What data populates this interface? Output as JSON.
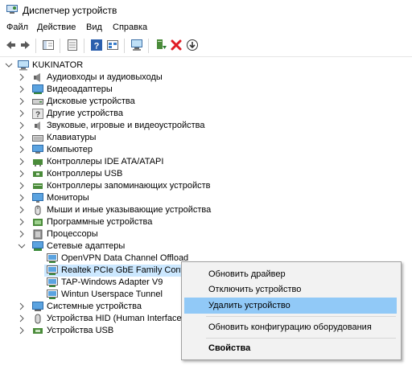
{
  "window": {
    "title": "Диспетчер устройств"
  },
  "menu": [
    {
      "id": "file",
      "label": "Файл"
    },
    {
      "id": "action",
      "label": "Действие"
    },
    {
      "id": "view",
      "label": "Вид"
    },
    {
      "id": "help",
      "label": "Справка"
    }
  ],
  "toolbar": {
    "icons": [
      "back-icon",
      "forward-icon",
      "show-hide-tree-icon",
      "properties-icon",
      "help-icon",
      "view-icon",
      "scan-hardware-icon",
      "update-driver-icon",
      "uninstall-icon",
      "disable-icon"
    ]
  },
  "tree": {
    "root": "KUKINATOR",
    "categories": [
      "Аудиовходы и аудиовыходы",
      "Видеоадаптеры",
      "Дисковые устройства",
      "Другие устройства",
      "Звуковые, игровые и видеоустройства",
      "Клавиатуры",
      "Компьютер",
      "Контроллеры IDE ATA/ATAPI",
      "Контроллеры USB",
      "Контроллеры запоминающих устройств",
      "Мониторы",
      "Мыши и иные указывающие устройства",
      "Программные устройства",
      "Процессоры",
      "Сетевые адаптеры"
    ],
    "network_children": [
      "OpenVPN Data Channel Offload",
      "Realtek PCIe GbE Family Controlle",
      "TAP-Windows Adapter V9",
      "Wintun Userspace Tunnel"
    ],
    "after": [
      "Системные устройства",
      "Устройства HID (Human Interface De",
      "Устройства USB"
    ]
  },
  "context_menu": {
    "update_driver": "Обновить драйвер",
    "disable_device": "Отключить устройство",
    "uninstall_device": "Удалить устройство",
    "scan_hardware": "Обновить конфигурацию оборудования",
    "properties": "Свойства"
  },
  "colors": {
    "selection": "#cce8ff",
    "menu_highlight": "#91c9f7",
    "delete_red": "#e01b24"
  }
}
